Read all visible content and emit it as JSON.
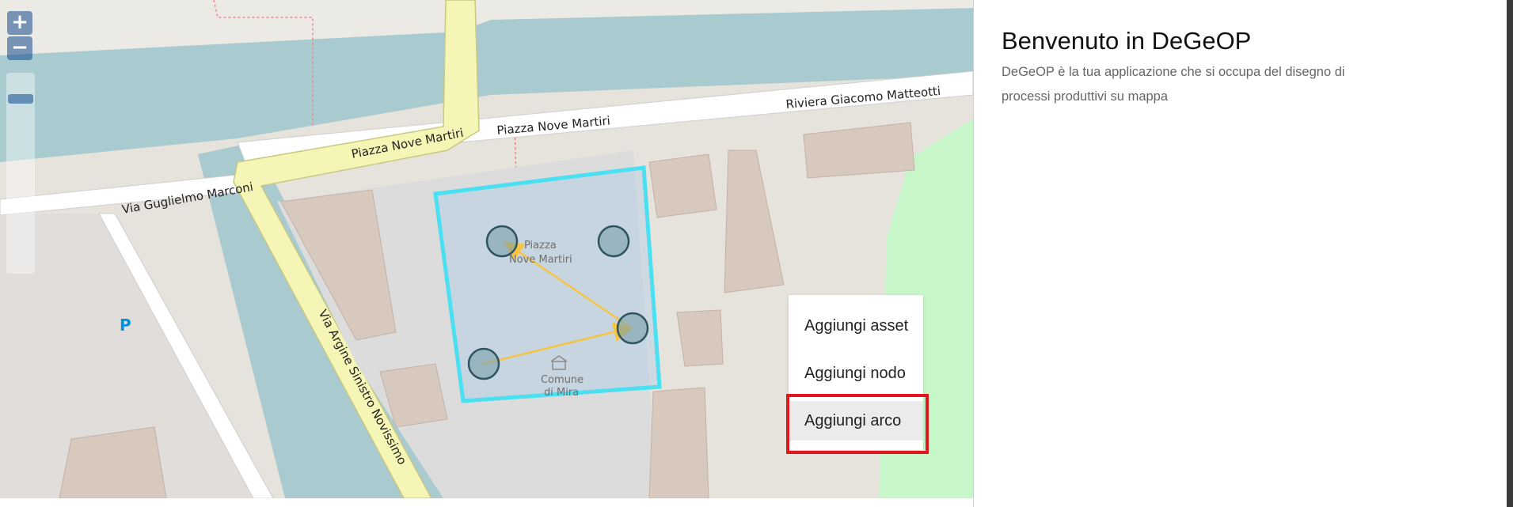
{
  "map": {
    "street_labels": {
      "piazza_1": "Piazza Nove Martiri",
      "piazza_2": "Piazza Nove Martiri",
      "riviera": "Riviera Giacomo Matteotti",
      "guglielmo": "Via Guglielmo Marconi",
      "argine": "Via Argine Sinistro Novissimo"
    },
    "poi_labels": {
      "piazza_line1": "Piazza",
      "piazza_line2": "Nove Martiri",
      "comune_line1": "Comune",
      "comune_line2": "di Mira"
    },
    "parking_symbol": "P",
    "zoom_in_symbol": "+",
    "zoom_out_symbol": "−",
    "colors": {
      "water": "#a9cbcf",
      "road_primary": "#f5f6b6",
      "building": "#d8c9bf",
      "park": "#c6f6c9",
      "selection": "#4ae0f2",
      "arrow": "#f6c443",
      "node_fill": "#9fb7bd",
      "node_stroke": "#2f5660"
    }
  },
  "context_menu": {
    "items": [
      "Aggiungi asset",
      "Aggiungi nodo",
      "Aggiungi arco"
    ]
  },
  "sidebar": {
    "title": "Benvenuto in DeGeOP",
    "description": "DeGeOP è la tua applicazione che si occupa del disegno di processi produttivi su mappa"
  }
}
